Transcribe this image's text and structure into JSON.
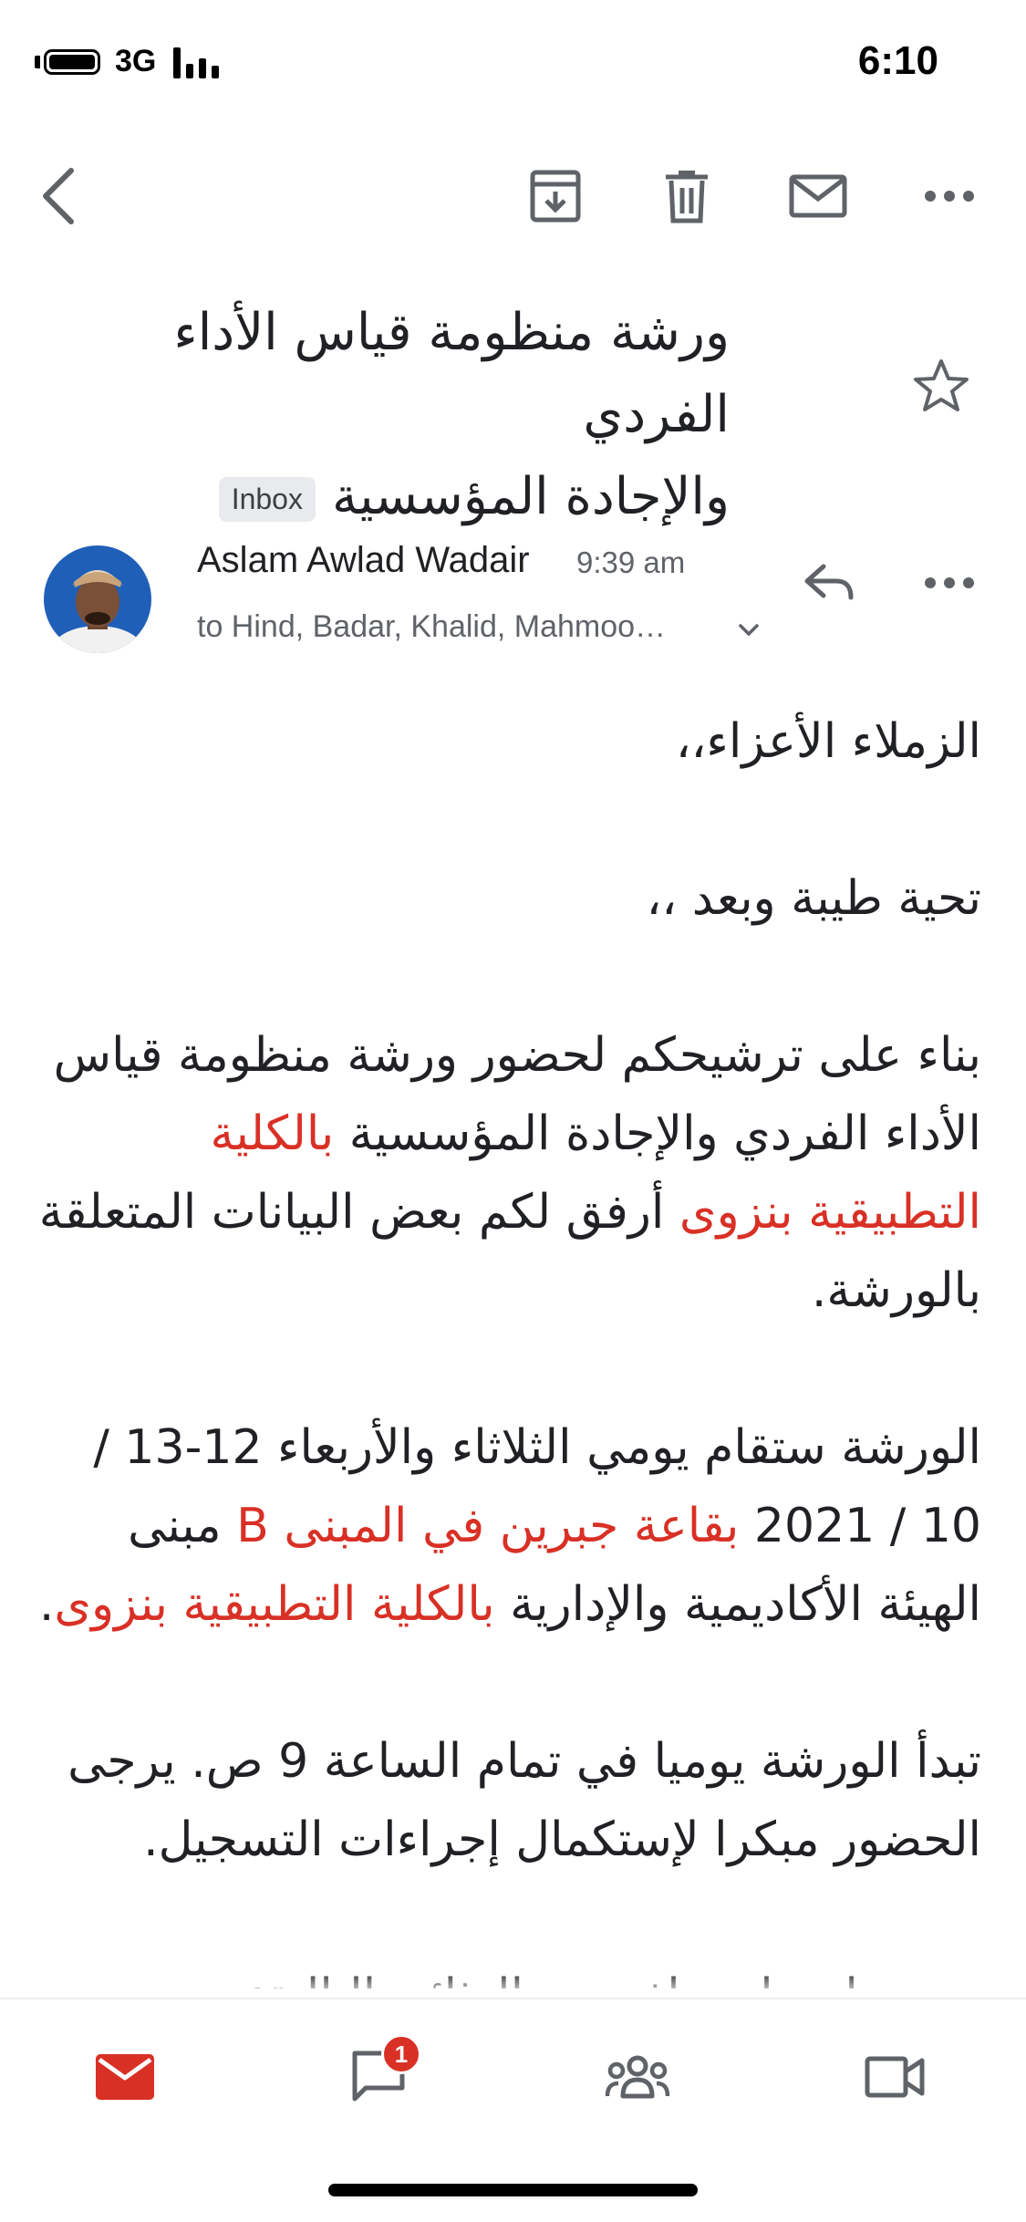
{
  "status_bar": {
    "network": "3G",
    "time": "6:10"
  },
  "toolbar": {
    "icons": [
      "back-arrow-icon",
      "archive-icon",
      "trash-icon",
      "mark-unread-icon",
      "more-icon"
    ]
  },
  "email": {
    "subject_line1": "ورشة منظومة قياس الأداء الفردي",
    "subject_line2": "والإجادة المؤسسية",
    "label": "Inbox",
    "sender": "Aslam Awlad Wadair",
    "time": "9:39 am",
    "recipients": "to Hind, Badar, Khalid, Mahmoo…",
    "body": {
      "greeting": "الزملاء الأعزاء،،",
      "salutation": "تحية طيبة وبعد ،،",
      "p1_a": "بناء على ترشيحكم لحضور ورشة منظومة قياس الأداء الفردي والإجادة المؤسسية ",
      "p1_red1": "بالكلية التطبيقية بنزوى",
      "p1_b": " أرفق لكم بعض البيانات المتعلقة بالورشة.",
      "p2_a": "الورشة ستقام يومي الثلاثاء والأربعاء 12-13 / 10 / 2021 ",
      "p2_red1": "بقاعة جبرين في المبنى B",
      "p2_b": " مبنى الهيئة الأكاديمية والإدارية ",
      "p2_red2": "بالكلية التطبيقية بنزوى",
      "p2_c": ".",
      "p3": "تبدأ الورشة يوميا في تمام الساعة 9 ص. يرجى الحضور مبكرا لإستكمال إجراءات التسجيل.",
      "p4": "يرجى إحضار نماذج من الوثائق التالية:"
    }
  },
  "bottom_nav": {
    "items": [
      "mail-icon",
      "chat-icon",
      "spaces-icon",
      "meet-icon"
    ],
    "chat_badge": "1"
  },
  "colors": {
    "red_accent": "#d93025",
    "icon_gray": "#5f6368"
  }
}
